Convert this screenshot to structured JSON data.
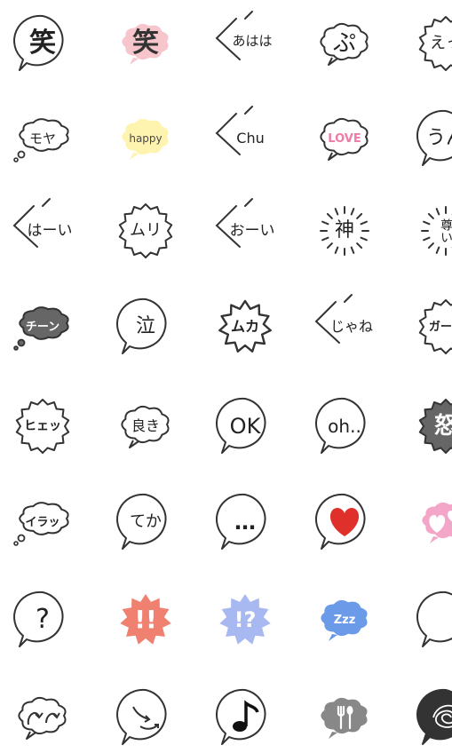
{
  "stickers": [
    {
      "text": "笑",
      "shape": "round",
      "fill": "#ffffff"
    },
    {
      "text": "笑",
      "shape": "cloud",
      "fill": "#f7c6cc"
    },
    {
      "text": "あはは",
      "shape": "angle",
      "fill": "#ffffff"
    },
    {
      "text": "ぷ",
      "shape": "cloud",
      "fill": "#ffffff"
    },
    {
      "text": "えっ",
      "shape": "spiky",
      "fill": "#ffffff"
    },
    {
      "text": "モヤ",
      "shape": "thought",
      "fill": "#ffffff"
    },
    {
      "text": "happy",
      "shape": "cloud",
      "fill": "#fff3b0"
    },
    {
      "text": "Chu",
      "shape": "angle",
      "fill": "#ffffff"
    },
    {
      "text": "LOVE",
      "shape": "cloud",
      "fill": "#ffffff"
    },
    {
      "text": "うん",
      "shape": "round",
      "fill": "#ffffff"
    },
    {
      "text": "はーい",
      "shape": "angle",
      "fill": "#ffffff"
    },
    {
      "text": "ムリ",
      "shape": "spiky",
      "fill": "#ffffff"
    },
    {
      "text": "おーい",
      "shape": "angle",
      "fill": "#ffffff"
    },
    {
      "text": "神",
      "shape": "rays",
      "fill": "#ffffff"
    },
    {
      "text": "尊い",
      "shape": "rays",
      "fill": "#ffffff"
    },
    {
      "text": "チーン",
      "shape": "thought",
      "fill": "#666666"
    },
    {
      "text": "泣",
      "shape": "round",
      "fill": "#ffffff"
    },
    {
      "text": "ムカ",
      "shape": "burst",
      "fill": "#ffffff"
    },
    {
      "text": "じゃね",
      "shape": "angle",
      "fill": "#ffffff"
    },
    {
      "text": "ガーン",
      "shape": "spiky",
      "fill": "#ffffff"
    },
    {
      "text": "ヒェッ",
      "shape": "spiky",
      "fill": "#ffffff"
    },
    {
      "text": "良き",
      "shape": "cloud",
      "fill": "#ffffff"
    },
    {
      "text": "OK",
      "shape": "round",
      "fill": "#ffffff"
    },
    {
      "text": "oh..",
      "shape": "round",
      "fill": "#ffffff"
    },
    {
      "text": "怒",
      "shape": "spiky",
      "fill": "#666666"
    },
    {
      "text": "イラッ",
      "shape": "thought",
      "fill": "#ffffff"
    },
    {
      "text": "てか",
      "shape": "round",
      "fill": "#ffffff"
    },
    {
      "text": "…",
      "shape": "round",
      "fill": "#ffffff"
    },
    {
      "text": "",
      "shape": "round",
      "fill": "#ffffff",
      "icon": "heart-icon"
    },
    {
      "text": "",
      "shape": "cloud",
      "fill": "#f4a6c8",
      "icon": "hearts-icon"
    },
    {
      "text": "?",
      "shape": "round",
      "fill": "#ffffff"
    },
    {
      "text": "!!",
      "shape": "burst",
      "fill": "#f08070"
    },
    {
      "text": "!?",
      "shape": "burst",
      "fill": "#a8b8f0"
    },
    {
      "text": "Zzz",
      "shape": "cloud",
      "fill": "#6a9ae8"
    },
    {
      "text": "",
      "shape": "round",
      "fill": "#ffffff",
      "icon": "drop-icon"
    },
    {
      "text": "",
      "shape": "cloud",
      "fill": "#ffffff",
      "icon": "swirl-arrows-icon"
    },
    {
      "text": "",
      "shape": "round",
      "fill": "#ffffff",
      "icon": "arrows-icon"
    },
    {
      "text": "",
      "shape": "round",
      "fill": "#ffffff",
      "icon": "music-note-icon"
    },
    {
      "text": "",
      "shape": "cloud",
      "fill": "#888888",
      "icon": "fork-spoon-icon"
    },
    {
      "text": "",
      "shape": "round",
      "fill": "#333333",
      "icon": "scribble-icon"
    }
  ]
}
